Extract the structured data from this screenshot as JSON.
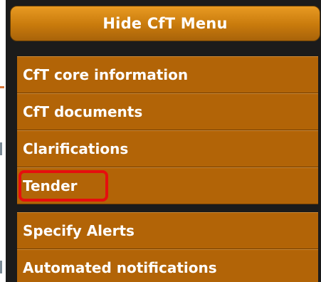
{
  "menu": {
    "toggle_label": "Hide CfT Menu",
    "items": [
      {
        "label": "CfT core information"
      },
      {
        "label": "CfT documents"
      },
      {
        "label": "Clarifications"
      },
      {
        "label": "Tender",
        "highlighted": true
      }
    ],
    "secondary_items": [
      {
        "label": "Specify Alerts"
      },
      {
        "label": "Automated notifications"
      }
    ]
  },
  "colors": {
    "menu_item_background": "#b26407",
    "toggle_button_background": "#c87a0c",
    "panel_background": "#1b1b1b",
    "highlight_outline": "#e60e0e",
    "text": "#ffffff"
  }
}
